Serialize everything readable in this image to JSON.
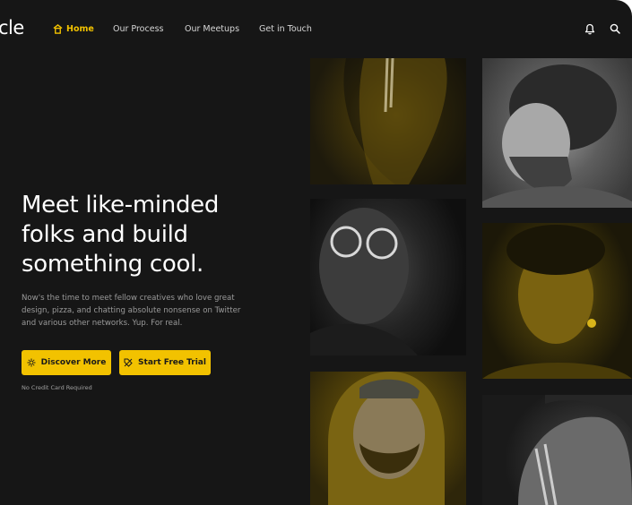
{
  "brand": {
    "logo_text": "cle"
  },
  "nav": {
    "items": [
      {
        "label": "Home",
        "active": true
      },
      {
        "label": "Our Process",
        "active": false
      },
      {
        "label": "Our Meetups",
        "active": false
      },
      {
        "label": "Get in Touch",
        "active": false
      }
    ],
    "icons": [
      "bell-icon",
      "search-icon"
    ]
  },
  "hero": {
    "headline_line1": "Meet like-minded",
    "headline_line2": "folks and build",
    "headline_line3": "something cool.",
    "subtext_line1": "Now's the time to meet fellow creatives who love great",
    "subtext_line2": "design, pizza, and chatting absolute nonsense on Twitter",
    "subtext_line3": "and various other networks. Yup. For real.",
    "primary_button": "Discover More",
    "secondary_button": "Start Free Trial",
    "note": "No Credit Card Required"
  },
  "colors": {
    "accent": "#f2c200",
    "background": "#161616",
    "text": "#ffffff",
    "muted": "#9a9a9a"
  },
  "gallery": {
    "photos": [
      "man-face-paint-yellow",
      "curly-haired-man-grayscale",
      "man-sunglasses-grayscale",
      "woman-earrings-yellow",
      "bearded-man-hoodie-yellow",
      "man-face-paint-grayscale"
    ]
  }
}
